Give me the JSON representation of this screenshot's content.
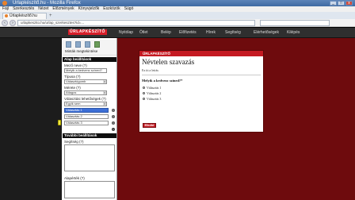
{
  "browser": {
    "window_title": "Űrlapkészítő.hu - Mozilla Firefox",
    "menu": [
      "Fájl",
      "Szerkesztés",
      "Nézet",
      "Előzmények",
      "Könyvjelzők",
      "Eszközök",
      "Súgó"
    ],
    "tab_label": "Űrlapkészítő.hu",
    "url": "urlapkeszito.hu/urlap_szerkesztes?id=...",
    "window_buttons": [
      "_",
      "□",
      "x"
    ]
  },
  "site": {
    "logo_text": "ŰRLAPKÉSZÍTŐ",
    "nav": [
      "Nyitólap",
      "Ötlet",
      "Belép",
      "Előfizetés",
      "Hírek",
      "Segítség",
      "Elérhetőségek",
      "Kilépés"
    ]
  },
  "sidebar": {
    "tool_label": "Minták megtekintése",
    "basic_header": "Alap beállítások",
    "name_label": "Mező neve (?)",
    "name_value": "Melyik a kedvenc színed?",
    "type_label": "Típusa (?)",
    "type_value": "Választógomb",
    "size_label": "Mérete (?)",
    "size_value": "Átlagos",
    "options_label": "Választási lehetőségek (?)",
    "options_select_value": "Egyik sem",
    "options": [
      "Választás 1",
      "Választás 2",
      "Választás 3"
    ],
    "more_header": "További beállítások",
    "help_label": "Segítség (?)",
    "default_label": "Alapérték (?)"
  },
  "form": {
    "card_header": "ŰRLAPKÉSZÍTŐ",
    "title": "Névtelen szavazás",
    "description": "Ez itt a leírás",
    "question": "Melyik a kedvenc színed?*",
    "choices": [
      "Választás 1",
      "Választás 2",
      "Választás 3"
    ],
    "submit": "Elküld"
  }
}
